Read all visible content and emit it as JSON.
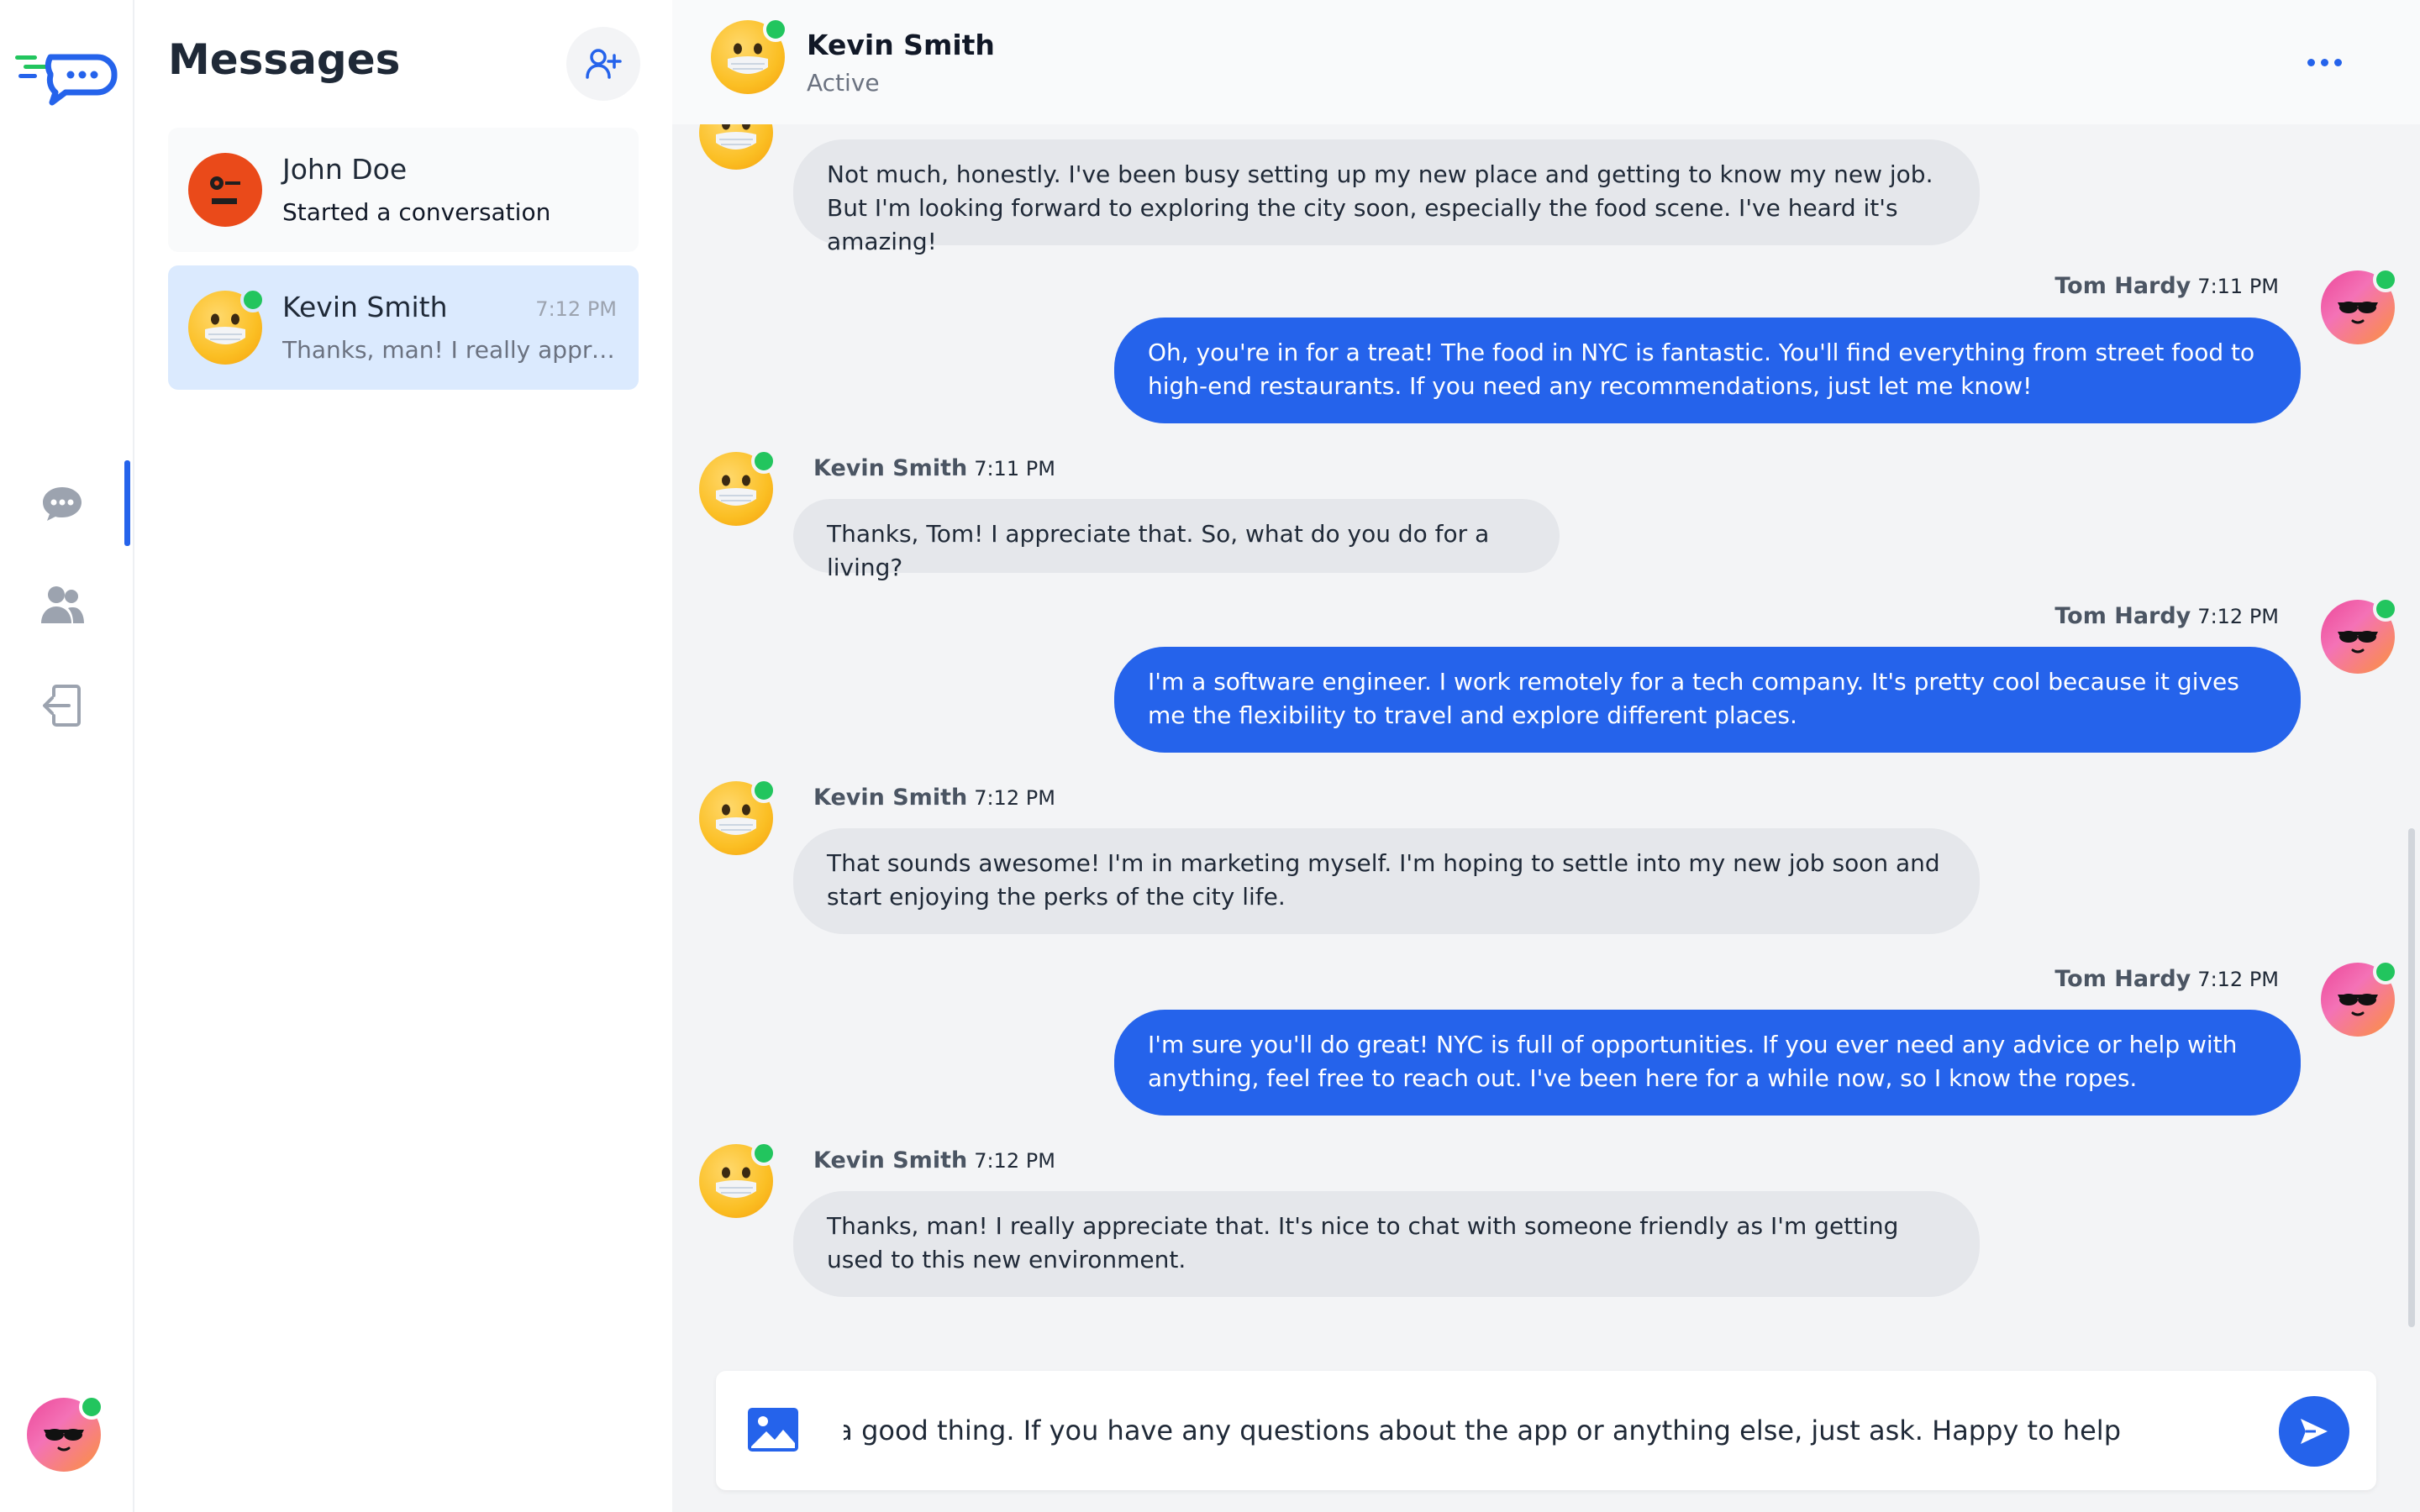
{
  "sidebar": {
    "active": "messages"
  },
  "conversations": {
    "title": "Messages",
    "items": [
      {
        "name": "John Doe",
        "time": "",
        "preview": "Started a conversation"
      },
      {
        "name": "Kevin Smith",
        "time": "7:12 PM",
        "preview": "Thanks, man! I really appreciate that. It's nice to chat with someone friendly as I'm getting used to this new environment."
      }
    ]
  },
  "chat": {
    "name": "Kevin Smith",
    "status": "Active",
    "messages": [
      {
        "direction": "in",
        "sender": "",
        "time": "",
        "text": "Not much, honestly. I've been busy setting up my new place and getting to know my new job. But I'm looking forward to exploring the city soon, especially the food scene. I've heard it's amazing!"
      },
      {
        "direction": "out",
        "sender": "Tom Hardy",
        "time": "7:11 PM",
        "text": "Oh, you're in for a treat! The food in NYC is fantastic. You'll find everything from street food to high-end restaurants. If you need any recommendations, just let me know!"
      },
      {
        "direction": "in",
        "sender": "Kevin Smith",
        "time": "7:11 PM",
        "text": "Thanks, Tom! I appreciate that. So, what do you do for a living?"
      },
      {
        "direction": "out",
        "sender": "Tom Hardy",
        "time": "7:12 PM",
        "text": "I'm a software engineer. I work remotely for a tech company. It's pretty cool because it gives me the flexibility to travel and explore different places."
      },
      {
        "direction": "in",
        "sender": "Kevin Smith",
        "time": "7:12 PM",
        "text": "That sounds awesome! I'm in marketing myself. I'm hoping to settle into my new job soon and start enjoying the perks of the city life."
      },
      {
        "direction": "out",
        "sender": "Tom Hardy",
        "time": "7:12 PM",
        "text": "I'm sure you'll do great! NYC is full of opportunities. If you ever need any advice or help with anything, feel free to reach out. I've been here for a while now, so I know the ropes."
      },
      {
        "direction": "in",
        "sender": "Kevin Smith",
        "time": "7:12 PM",
        "text": "Thanks, man! I really appreciate that. It's nice to chat with someone friendly as I'm getting used to this new environment."
      }
    ]
  },
  "composer": {
    "value": "riends is always a good thing. If you have any questions about the app or anything else, just ask. Happy to help!"
  },
  "colors": {
    "accent": "#2563eb",
    "online": "#22c55e",
    "incoming_bubble": "#e5e7eb",
    "outgoing_bubble": "#2563eb"
  }
}
